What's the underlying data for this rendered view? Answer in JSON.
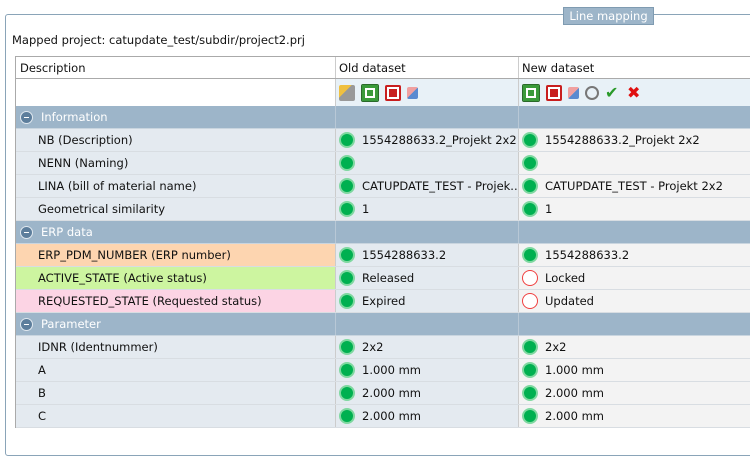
{
  "panel": {
    "legend": "Line mapping",
    "mapped_project": "Mapped project: catupdate_test/subdir/project2.prj"
  },
  "columns": [
    "Description",
    "Old dataset",
    "New dataset"
  ],
  "toolbar": {
    "old": [
      "filter-icon",
      "sync-icon",
      "export-icon",
      "copy-icon"
    ],
    "new": [
      "sync-icon",
      "export-icon",
      "copy-icon",
      "inspect-icon",
      "accept-icon",
      "reject-icon"
    ]
  },
  "colors": {
    "group": "#9db5c9",
    "ok": "#00b050",
    "bad": "#f04040",
    "erp": "#fdd5b0",
    "active": "#cdf5a0",
    "requested": "#fcd4e4"
  },
  "groups": [
    {
      "label": "Information",
      "rows": [
        {
          "desc": "NB (Description)",
          "old": "1554288633.2_Projekt 2x2",
          "old_status": "ok",
          "new": "1554288633.2_Projekt 2x2",
          "new_status": "ok"
        },
        {
          "desc": "NENN (Naming)",
          "old": "",
          "old_status": "ok",
          "new": "",
          "new_status": "ok"
        },
        {
          "desc": "LINA (bill of material name)",
          "old": "CATUPDATE_TEST - Projek...",
          "old_status": "ok",
          "new": "CATUPDATE_TEST - Projekt 2x2",
          "new_status": "ok"
        },
        {
          "desc": "Geometrical similarity",
          "old": "1",
          "old_status": "ok",
          "new": "1",
          "new_status": "ok"
        }
      ]
    },
    {
      "label": "ERP data",
      "rows": [
        {
          "desc": "ERP_PDM_NUMBER (ERP number)",
          "old": "1554288633.2",
          "old_status": "ok",
          "new": "1554288633.2",
          "new_status": "ok",
          "color": "#fdd5b0"
        },
        {
          "desc": "ACTIVE_STATE (Active status)",
          "old": "Released",
          "old_status": "ok",
          "new": "Locked",
          "new_status": "bad",
          "color": "#cdf5a0"
        },
        {
          "desc": "REQUESTED_STATE (Requested status)",
          "old": "Expired",
          "old_status": "ok",
          "new": "Updated",
          "new_status": "bad",
          "color": "#fcd4e4"
        }
      ]
    },
    {
      "label": "Parameter",
      "rows": [
        {
          "desc": "IDNR (Identnummer)",
          "old": "2x2",
          "old_status": "ok",
          "new": "2x2",
          "new_status": "ok"
        },
        {
          "desc": "A",
          "old": "1.000 mm",
          "old_status": "ok",
          "new": "1.000 mm",
          "new_status": "ok"
        },
        {
          "desc": "B",
          "old": "2.000 mm",
          "old_status": "ok",
          "new": "2.000 mm",
          "new_status": "ok"
        },
        {
          "desc": "C",
          "old": "2.000 mm",
          "old_status": "ok",
          "new": "2.000 mm",
          "new_status": "ok"
        }
      ]
    }
  ]
}
